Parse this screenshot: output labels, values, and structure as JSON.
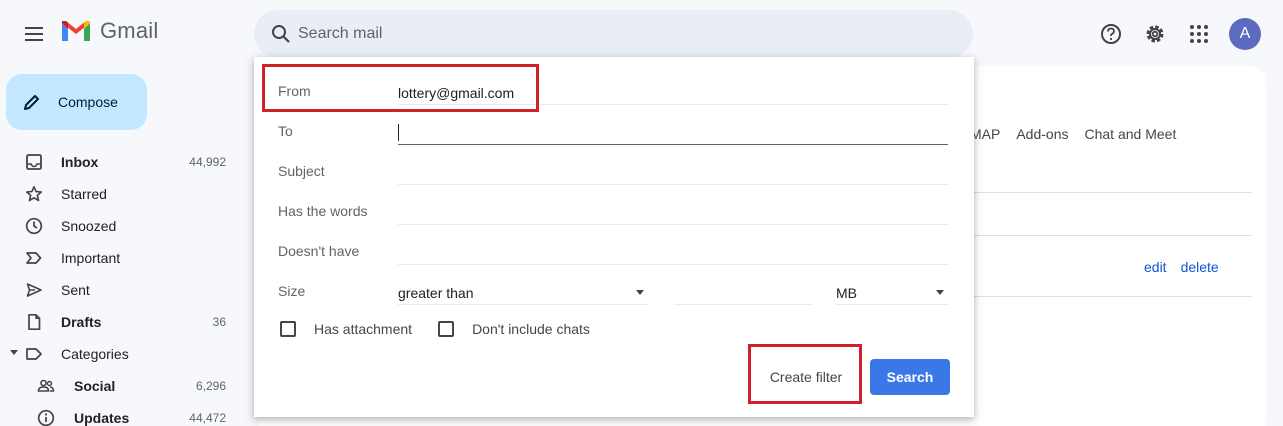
{
  "app": {
    "name": "Gmail",
    "avatar_letter": "A"
  },
  "search": {
    "placeholder": "Search mail"
  },
  "compose": {
    "label": "Compose"
  },
  "sidebar": {
    "items": [
      {
        "label": "Inbox",
        "count": "44,992",
        "icon": "inbox-icon"
      },
      {
        "label": "Starred",
        "count": "",
        "icon": "star-icon"
      },
      {
        "label": "Snoozed",
        "count": "",
        "icon": "clock-icon"
      },
      {
        "label": "Important",
        "count": "",
        "icon": "important-icon"
      },
      {
        "label": "Sent",
        "count": "",
        "icon": "send-icon"
      },
      {
        "label": "Drafts",
        "count": "36",
        "icon": "draft-icon"
      },
      {
        "label": "Categories",
        "count": "",
        "icon": "label-icon"
      },
      {
        "label": "Social",
        "count": "6,296",
        "icon": "people-icon"
      },
      {
        "label": "Updates",
        "count": "44,472",
        "icon": "info-icon"
      }
    ]
  },
  "background": {
    "tabs": [
      "MAP",
      "Add-ons",
      "Chat and Meet"
    ],
    "links": {
      "edit": "edit",
      "delete": "delete"
    }
  },
  "filter_dialog": {
    "from": {
      "label": "From",
      "value": "lottery@gmail.com"
    },
    "to": {
      "label": "To",
      "value": ""
    },
    "subject": {
      "label": "Subject",
      "value": ""
    },
    "has_words": {
      "label": "Has the words",
      "value": ""
    },
    "doesnt_have": {
      "label": "Doesn't have",
      "value": ""
    },
    "size": {
      "label": "Size",
      "comparator": "greater than",
      "unit": "MB"
    },
    "has_attachment": "Has attachment",
    "dont_include_chats": "Don't include chats",
    "create_filter": "Create filter",
    "search_button": "Search"
  },
  "colors": {
    "accent": "#3b78e7",
    "highlight": "#d0212a",
    "compose_bg": "#c2e7ff"
  }
}
